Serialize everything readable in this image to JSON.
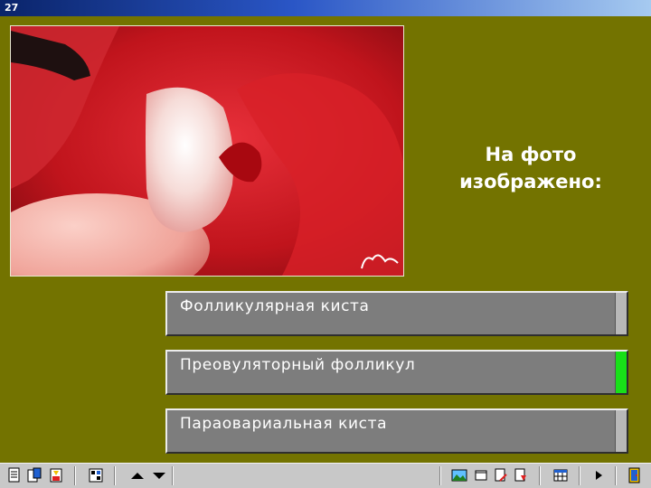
{
  "window": {
    "title": "27"
  },
  "question": {
    "line1": "На фото",
    "line2": "изображено:"
  },
  "answers": [
    {
      "label": "Фолликулярная киста",
      "state": "neutral"
    },
    {
      "label": "Преовуляторный фолликул",
      "state": "correct"
    },
    {
      "label": "Параовариальная киста",
      "state": "neutral"
    }
  ],
  "colors": {
    "background": "#737300",
    "answer_bg": "#7d7d7d",
    "indicator_neutral": "#b8b8b8",
    "indicator_correct": "#18e018"
  },
  "toolbar": {
    "left_icons": [
      "document-icon",
      "clipboard-icon",
      "info-book-icon",
      "grid-icon",
      "arrow-up-icon",
      "arrow-down-icon"
    ],
    "right_icons": [
      "landscape-icon",
      "window-icon",
      "edit-icon",
      "bookmark-icon",
      "calendar-icon",
      "play-icon",
      "exit-door-icon"
    ]
  }
}
